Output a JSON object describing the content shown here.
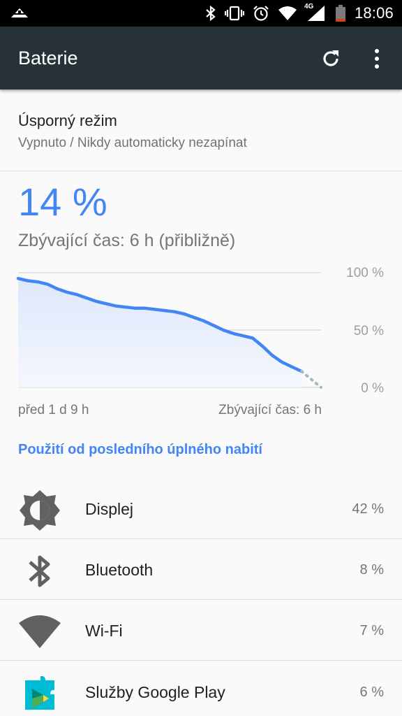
{
  "status_bar": {
    "time": "18:06",
    "network": "4G",
    "icons": [
      "notification-icon",
      "bluetooth-icon",
      "vibrate-icon",
      "alarm-icon",
      "wifi-icon",
      "signal-icon",
      "battery-icon"
    ]
  },
  "app_bar": {
    "title": "Baterie",
    "actions": [
      "refresh-icon",
      "more-options-icon"
    ]
  },
  "battery_saver": {
    "title": "Úsporný režim",
    "subtitle": "Vypnuto / Nikdy automaticky nezapínat"
  },
  "battery": {
    "percent": "14 %",
    "remaining": "Zbývající čas: 6 h (přibližně)"
  },
  "chart_data": {
    "type": "line",
    "y_ticks": [
      "100 %",
      "50 %",
      "0 %"
    ],
    "ylim": [
      0,
      100
    ],
    "x_start_label": "před 1 d 9 h",
    "x_end_label": "Zbývající čas: 6 h",
    "series": [
      {
        "values": [
          95,
          93,
          92,
          90,
          86,
          83,
          81,
          78,
          75,
          73,
          71,
          70,
          69,
          69,
          68,
          67,
          66,
          64,
          61,
          58,
          54,
          50,
          47,
          45,
          43,
          36,
          28,
          22,
          18,
          14
        ]
      }
    ],
    "projection": [
      14,
      7,
      0
    ],
    "colors": {
      "line": "#4285f4",
      "fill": "#dde7fb",
      "projection": "#a8b8c0",
      "grid": "#d0d0d0"
    }
  },
  "usage": {
    "title": "Použití od posledního úplného nabití",
    "items": [
      {
        "label": "Displej",
        "value": "42 %",
        "icon": "brightness-icon"
      },
      {
        "label": "Bluetooth",
        "value": "8 %",
        "icon": "bluetooth-icon"
      },
      {
        "label": "Wi-Fi",
        "value": "7 %",
        "icon": "wifi-icon"
      },
      {
        "label": "Služby Google Play",
        "value": "6 %",
        "icon": "google-play-services-icon"
      }
    ]
  }
}
